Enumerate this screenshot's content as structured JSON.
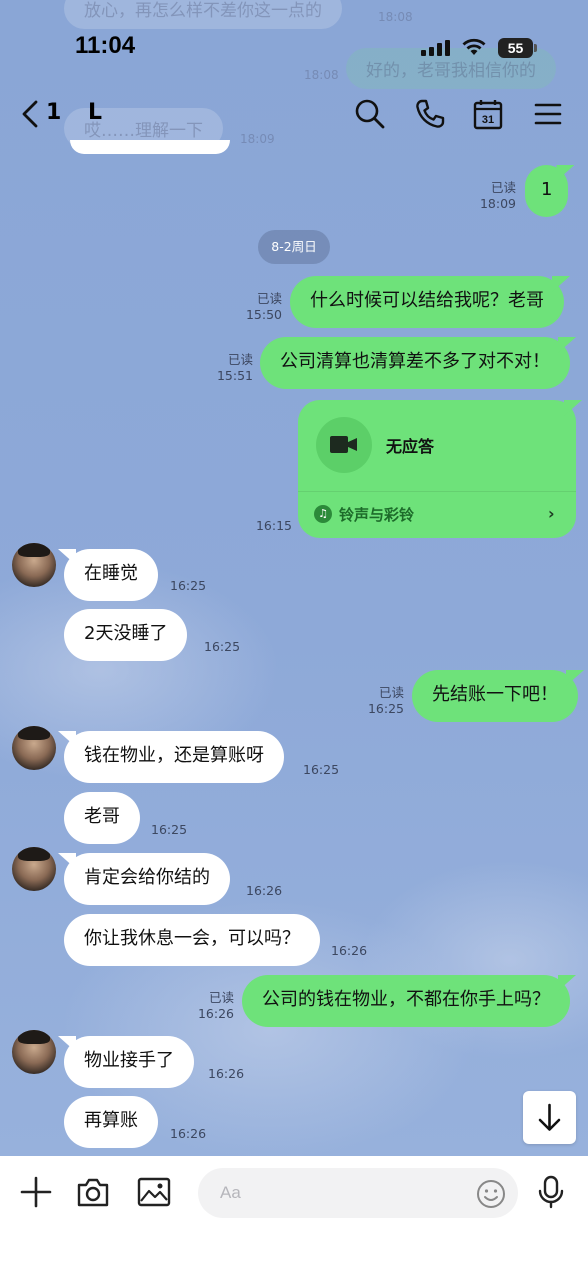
{
  "status_bar": {
    "time": "11:04",
    "battery": "55"
  },
  "header": {
    "unread_count": "1",
    "contact_name": "L"
  },
  "ghost_messages": [
    {
      "text": "放心，再怎么样不差你这一点的",
      "time": "18:08"
    },
    {
      "text": "好的，老哥我相信你的",
      "time": "18:08"
    },
    {
      "text": "哎……理解一下",
      "time": "18:09"
    }
  ],
  "date_divider": "8-2周日",
  "messages": [
    {
      "dir": "out",
      "text": "1",
      "read": "已读",
      "time": "18:09"
    },
    {
      "dir": "out",
      "text": "什么时候可以结给我呢？老哥",
      "read": "已读",
      "time": "15:50"
    },
    {
      "dir": "out",
      "text": "公司清算也清算差不多了对不对！",
      "read": "已读",
      "time": "15:51"
    },
    {
      "dir": "out",
      "type": "call",
      "call_status": "无应答",
      "ringtone_label": "铃声与彩铃",
      "time": "16:15"
    },
    {
      "dir": "in",
      "text": "在睡觉",
      "time": "16:25"
    },
    {
      "dir": "in",
      "text": "2天没睡了",
      "time": "16:25"
    },
    {
      "dir": "out",
      "text": "先结账一下吧！",
      "read": "已读",
      "time": "16:25"
    },
    {
      "dir": "in",
      "text": "钱在物业，还是算账呀",
      "time": "16:25"
    },
    {
      "dir": "in",
      "text": "老哥",
      "time": "16:25"
    },
    {
      "dir": "in",
      "text": "肯定会给你结的",
      "time": "16:26"
    },
    {
      "dir": "in",
      "text": "你让我休息一会，可以吗？",
      "time": "16:26"
    },
    {
      "dir": "out",
      "text": "公司的钱在物业，不都在你手上吗？",
      "read": "已读",
      "time": "16:26"
    },
    {
      "dir": "in",
      "text": "物业接手了",
      "time": "16:26"
    },
    {
      "dir": "in",
      "text": "再算账",
      "time": "16:26"
    }
  ],
  "input": {
    "placeholder": "Aa"
  },
  "icons": {
    "header": [
      "search-icon",
      "phone-icon",
      "calendar-icon",
      "menu-icon"
    ],
    "calendar_day": "31",
    "input_bar": [
      "plus-icon",
      "camera-icon",
      "image-icon",
      "emoji-icon",
      "microphone-icon"
    ]
  },
  "colors": {
    "outgoing_bubble": "#6ee27a",
    "incoming_bubble": "#ffffff",
    "chat_background": "#8fa9d6"
  }
}
